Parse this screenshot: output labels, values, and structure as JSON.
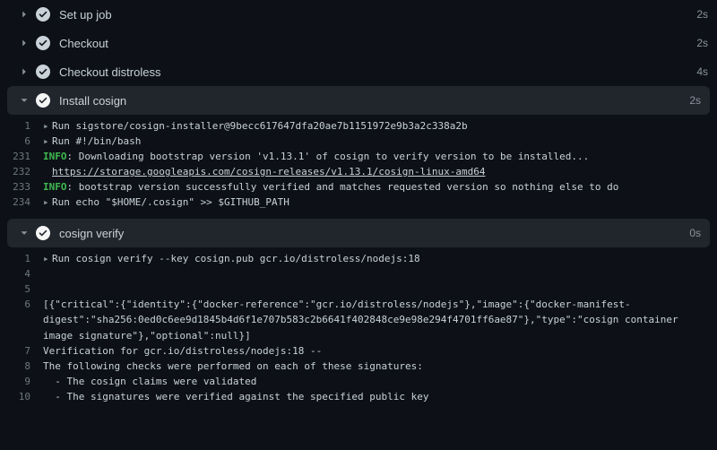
{
  "steps": {
    "setup": {
      "label": "Set up job",
      "duration": "2s"
    },
    "checkout": {
      "label": "Checkout",
      "duration": "2s"
    },
    "distro": {
      "label": "Checkout distroless",
      "duration": "4s"
    },
    "install": {
      "label": "Install cosign",
      "duration": "2s"
    },
    "verify": {
      "label": "cosign verify",
      "duration": "0s"
    }
  },
  "install_log": {
    "l1": {
      "no": "1",
      "txt": "Run sigstore/cosign-installer@9becc617647dfa20ae7b1151972e9b3a2c338a2b"
    },
    "l6": {
      "no": "6",
      "txt": "Run #!/bin/bash"
    },
    "l231": {
      "no": "231",
      "pre": "INFO",
      "txt": ": Downloading bootstrap version 'v1.13.1' of cosign to verify version to be installed..."
    },
    "l232": {
      "no": "232",
      "url": "https://storage.googleapis.com/cosign-releases/v1.13.1/cosign-linux-amd64"
    },
    "l233": {
      "no": "233",
      "pre": "INFO",
      "txt": ": bootstrap version successfully verified and matches requested version so nothing else to do"
    },
    "l234": {
      "no": "234",
      "txt": "Run echo \"$HOME/.cosign\" >> $GITHUB_PATH"
    }
  },
  "verify_log": {
    "l1": {
      "no": "1",
      "txt": "Run cosign verify --key cosign.pub gcr.io/distroless/nodejs:18"
    },
    "l4": {
      "no": "4",
      "txt": ""
    },
    "l5": {
      "no": "5",
      "txt": ""
    },
    "l6": {
      "no": "6",
      "txt": "[{\"critical\":{\"identity\":{\"docker-reference\":\"gcr.io/distroless/nodejs\"},\"image\":{\"docker-manifest-digest\":\"sha256:0ed0c6ee9d1845b4d6f1e707b583c2b6641f402848ce9e98e294f4701ff6ae87\"},\"type\":\"cosign container image signature\"},\"optional\":null}]"
    },
    "l7": {
      "no": "7",
      "txt": "Verification for gcr.io/distroless/nodejs:18 --"
    },
    "l8": {
      "no": "8",
      "txt": "The following checks were performed on each of these signatures:"
    },
    "l9": {
      "no": "9",
      "txt": "  - The cosign claims were validated"
    },
    "l10": {
      "no": "10",
      "txt": "  - The signatures were verified against the specified public key"
    }
  }
}
